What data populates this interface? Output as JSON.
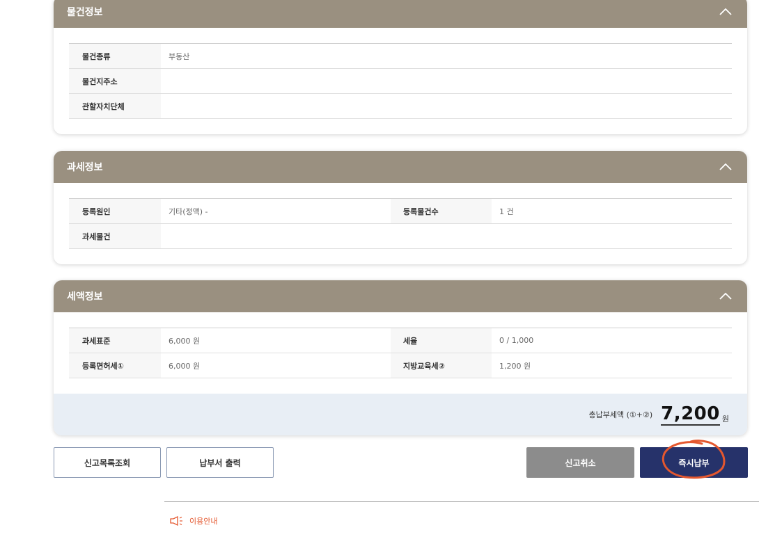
{
  "sections": {
    "property": {
      "title": "물건정보",
      "rows": [
        {
          "label": "물건종류",
          "value": "부동산"
        },
        {
          "label": "물건지주소",
          "value": ""
        },
        {
          "label": "관할자치단체",
          "value": ""
        }
      ]
    },
    "taxation": {
      "title": "과세정보",
      "reason_label": "등록원인",
      "reason_value": "기타(정액) -",
      "count_label": "등록물건수",
      "count_value": "1 건",
      "object_label": "과세물건",
      "object_value": ""
    },
    "tax_amount": {
      "title": "세액정보",
      "base_label": "과세표준",
      "base_value": "6,000 원",
      "rate_label": "세율",
      "rate_value": "0 / 1,000",
      "license_tax_label": "등록면허세①",
      "license_tax_value": "6,000 원",
      "edu_tax_label": "지방교육세②",
      "edu_tax_value": "1,200 원",
      "total_label": "총납부세액 (①+②)",
      "total_value": "7,200",
      "total_unit": "원"
    }
  },
  "buttons": {
    "report_list": "신고목록조회",
    "print_bill": "납부서 출력",
    "cancel_report": "신고취소",
    "pay_now": "즉시납부"
  },
  "guide": {
    "label": "이용안내"
  },
  "colors": {
    "header_bg": "#9a9080",
    "pay_button": "#26326a",
    "cancel_button": "#8c8c8c",
    "total_bar_bg": "#e8eef5",
    "annotation": "#e4572e"
  }
}
